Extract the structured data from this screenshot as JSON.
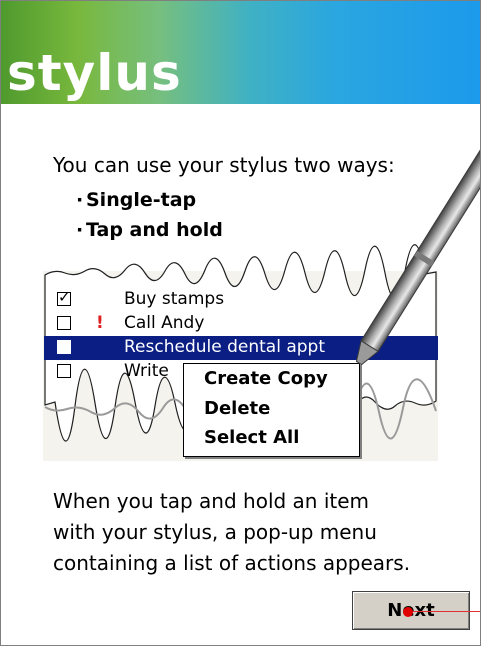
{
  "banner": {
    "title": "stylus"
  },
  "intro": {
    "text": "You can use your stylus two ways:",
    "bullets": [
      "Single-tap",
      "Tap and hold"
    ]
  },
  "demo": {
    "items": [
      {
        "label": "Buy stamps",
        "checked": true,
        "priority": "",
        "selected": false
      },
      {
        "label": "Call Andy",
        "checked": false,
        "priority": "!",
        "selected": false
      },
      {
        "label": "Reschedule dental appt",
        "checked": false,
        "priority": "",
        "selected": true
      },
      {
        "label": "Write",
        "checked": false,
        "priority": "",
        "selected": false
      }
    ],
    "popup_menu": [
      "Create Copy",
      "Delete",
      "Select All"
    ]
  },
  "description": [
    "When you tap and hold an item",
    "with your stylus, a pop-up menu",
    "containing a list of actions appears."
  ],
  "next_button": {
    "label": "Next"
  },
  "colors": {
    "selection": "#0a1e84",
    "priority": "#e02020",
    "tap_marker": "#e00000",
    "banner_start": "#4f9a2e",
    "banner_end": "#1c9aeb"
  },
  "icons": {
    "stylus": "stylus-pen-illustration",
    "check": "checkmark",
    "priority": "exclamation-priority"
  }
}
